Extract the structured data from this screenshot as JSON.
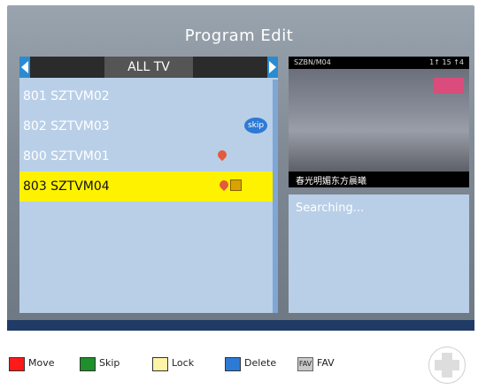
{
  "title": "Program Edit",
  "group": {
    "label": "ALL TV"
  },
  "channels": [
    {
      "label": "801 SZTVM02",
      "icons": []
    },
    {
      "label": "802 SZTVM03",
      "icons": [
        "skip"
      ]
    },
    {
      "label": "800 SZTVM01",
      "icons": [
        "fav"
      ]
    },
    {
      "label": "803 SZTVM04",
      "icons": [
        "fav",
        "lock"
      ],
      "selected": true
    }
  ],
  "preview": {
    "top_left": "SZBN/M04",
    "top_right": "1↑ 15 ↑4",
    "caption": "春光明媚东方晨曦"
  },
  "info": {
    "status": "Searching..."
  },
  "legend": {
    "move": "Move",
    "skip": "Skip",
    "lock": "Lock",
    "delete": "Delete",
    "fav_key": "FAV",
    "fav_label": "FAV"
  },
  "colors": {
    "move": "#ff1a1a",
    "skip": "#1f8f2c",
    "lock": "#fff3a6",
    "delete": "#2c7ad6"
  }
}
